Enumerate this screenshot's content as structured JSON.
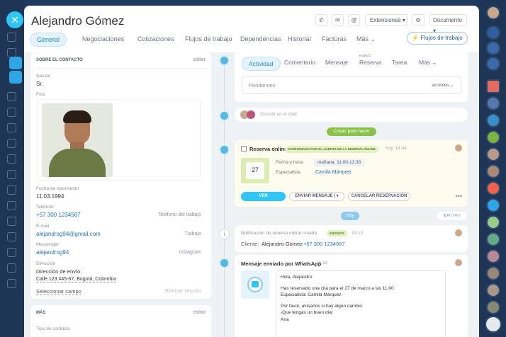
{
  "contact": {
    "name": "Alejandro Gómez"
  },
  "header": {
    "extensiones": "Extensiones",
    "documento": "Documento"
  },
  "tabs": [
    "General",
    "Negociaciones",
    "Cotizaciones",
    "Flujos de trabajo",
    "Dependencias",
    "Historial",
    "Facturas",
    "Más"
  ],
  "flujos_button": "Flujos de trabajo",
  "about": {
    "heading": "SOBRE EL CONTACTO",
    "edit": "editar",
    "saludo_label": "Saludo",
    "saludo": "Sr.",
    "foto_label": "Foto",
    "birth_label": "Fecha de nacimiento",
    "birth": "11.03.1994",
    "phone_label": "Teléfono",
    "phone": "+57 300 1234567",
    "phone_type": "Teléfono del trabajo",
    "email_label": "E-mail",
    "email": "alejandrog94@gmail.com",
    "email_type": "Trabajo",
    "messenger_label": "Messenger",
    "messenger": "alejandrog94",
    "messenger_type": "Instagram",
    "address_label": "Dirección",
    "address_sub": "Dirección de envío:",
    "address": "Calle 123 #45-67, Bogotá, Colombia",
    "select_field": "Seleccionar campo",
    "remove_section": "Eliminar sección"
  },
  "mas": {
    "heading": "MÁS",
    "edit": "editar",
    "tipo_label": "Tipo de contacto"
  },
  "activity": {
    "tabs": [
      "Actividad",
      "Comentario",
      "Mensaje",
      "Reserva",
      "Tarea",
      "Más"
    ],
    "nuevo": "NUEVO",
    "pending": "Pendientes",
    "acciones": "acciones"
  },
  "chat": {
    "placeholder": "Discutir en el chat"
  },
  "todo_label": "Cosas para hacer",
  "reserva": {
    "title": "Reserva online",
    "badge": "CONFIRMADO POR EL AGENTE DE LA RESERVA ONLINE",
    "time": "hoy, 14:44",
    "date_label": "Fecha y hora:",
    "date": "mañana, 11:00-12:30",
    "spec_label": "Especialista",
    "spec": "Camila Márquez",
    "cal_day": "27",
    "ver": "VER",
    "enviar": "ENVIAR MENSAJE",
    "cancelar": "CANCELAR RESERVACIÓN"
  },
  "today": "Hoy",
  "filtro": "FILTRO",
  "notif": {
    "title": "Notificación de reserva online creada",
    "badge": "ENVIADO",
    "time": "15:10",
    "cliente_label": "Cliente:",
    "cliente": "Alejandro Gómez",
    "phone": "+57 300 1234567"
  },
  "whatsapp": {
    "title": "Mensaje enviado por WhatsApp",
    "time": "15:10",
    "lines": [
      "Hola, Alejandro:",
      "Has reservado una cita para el 27 de marzo a las 11:00",
      "Especialista: Camila Márquez",
      "Por favor, avísanos si hay algún cambio.",
      "¡Que tengas un buen día!",
      "Ana"
    ]
  },
  "colors": {
    "accent": "#2fc6f6",
    "sidebar": "#1e3556",
    "green": "#9dcf00"
  }
}
